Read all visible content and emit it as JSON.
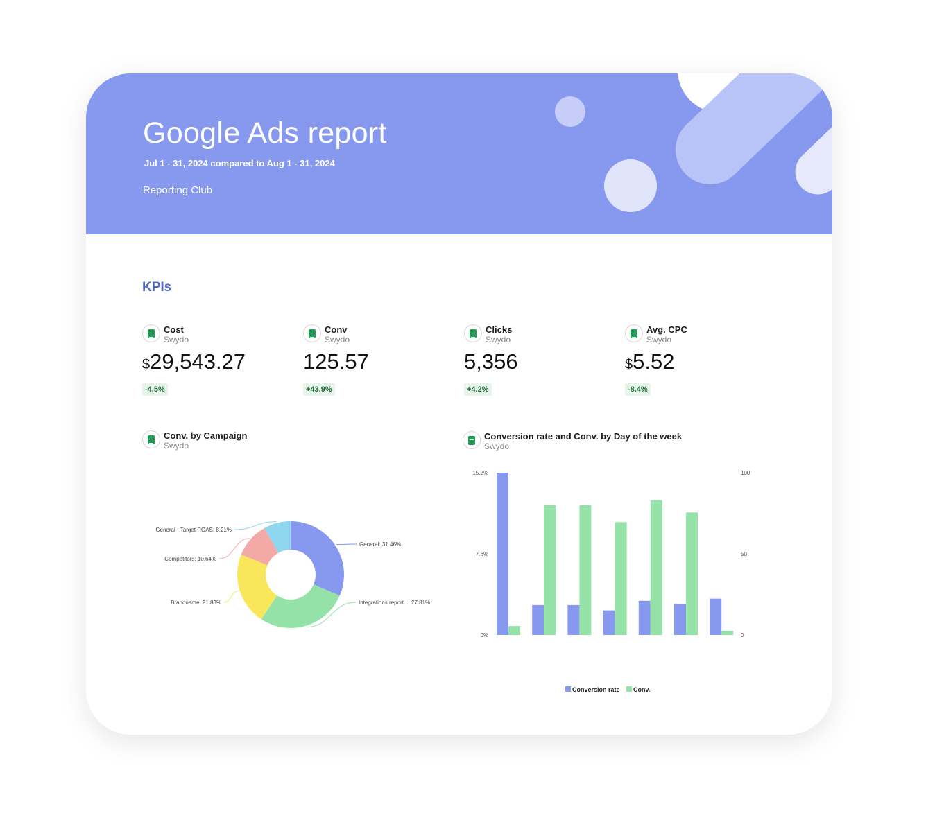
{
  "header": {
    "title": "Google Ads report",
    "date_range": "Jul 1 - 31, 2024 compared to Aug 1 - 31, 2024",
    "organization": "Reporting Club"
  },
  "kpis": {
    "section_title": "KPIs",
    "items": [
      {
        "label": "Cost",
        "source": "Swydo",
        "currency": "$",
        "value": "29,543.27",
        "delta": "-4.5%"
      },
      {
        "label": "Conv",
        "source": "Swydo",
        "currency": "",
        "value": "125.57",
        "delta": "+43.9%"
      },
      {
        "label": "Clicks",
        "source": "Swydo",
        "currency": "",
        "value": "5,356",
        "delta": "+4.2%"
      },
      {
        "label": "Avg. CPC",
        "source": "Swydo",
        "currency": "$",
        "value": "5.52",
        "delta": "-8.4%"
      }
    ]
  },
  "icons": {
    "source": "google-sheets-icon"
  },
  "colors": {
    "banner": "#8699ee",
    "accent": "#4f67c9",
    "conversion_rate": "#8699ee",
    "conv": "#94e2a8",
    "delta_bg": "#e6f4ea",
    "delta_text": "#1e6b35"
  },
  "chart_data": [
    {
      "type": "pie",
      "donut": true,
      "title": "Conv. by Campaign",
      "source": "Swydo",
      "slices": [
        {
          "label": "General: 31.46%",
          "value": 31.46,
          "color": "#8699ee"
        },
        {
          "label": "Integrations report...: 27.81%",
          "value": 27.81,
          "color": "#94e2a8"
        },
        {
          "label": "Brandname: 21.88%",
          "value": 21.88,
          "color": "#f8e75a"
        },
        {
          "label": "Competitors: 10.64%",
          "value": 10.64,
          "color": "#f3aaa6"
        },
        {
          "label": "General - Target ROAS: 8.21%",
          "value": 8.21,
          "color": "#8fd6ef"
        }
      ]
    },
    {
      "type": "bar",
      "title": "Conversion rate and Conv. by Day of the week",
      "source": "Swydo",
      "categories": [
        "",
        "",
        "",
        "",
        "",
        "",
        ""
      ],
      "y_left": {
        "ticks": [
          "15.2%",
          "7.6%",
          "0%"
        ],
        "range": [
          0,
          15.2
        ]
      },
      "y_right": {
        "ticks": [
          "100",
          "50",
          "0"
        ],
        "range": [
          0,
          100
        ]
      },
      "series": [
        {
          "name": "Conversion rate",
          "axis": "left",
          "color": "#8699ee",
          "values": [
            15.2,
            2.8,
            2.8,
            2.3,
            3.2,
            2.9,
            3.4
          ]
        },
        {
          "name": "Conv.",
          "axis": "right",
          "color": "#94e2a8",
          "values": [
            5.5,
            80,
            80,
            69.5,
            83,
            75.5,
            2.5
          ]
        }
      ],
      "legend": "bottom"
    }
  ]
}
